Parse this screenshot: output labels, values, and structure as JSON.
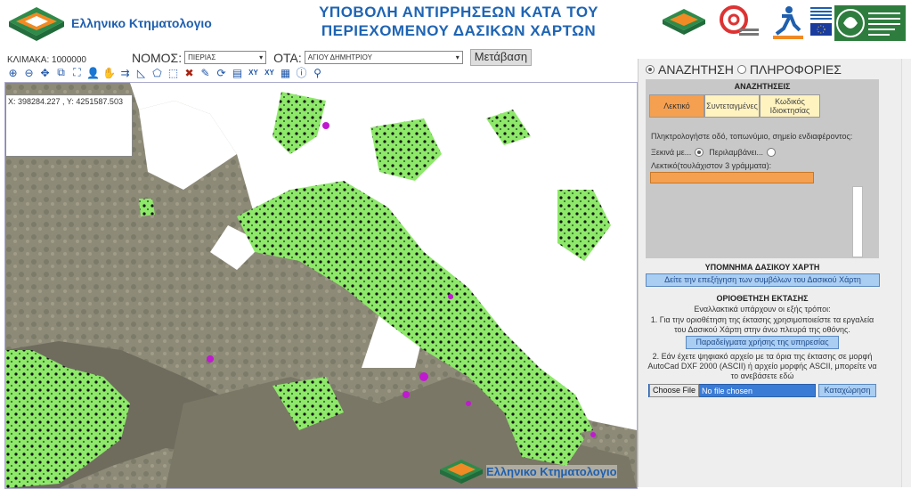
{
  "header": {
    "logo_text": "Ελληνικο Κτηματολογιο",
    "title_line1": "ΥΠΟΒΟΛΗ ΑΝΤΙΡΡΗΣΕΩΝ ΚΑΤΑ ΤΟΥ",
    "title_line2": "ΠΕΡΙΕΧΟΜΕΝΟΥ ΔΑΣΙΚΩΝ ΧΑΡΤΩΝ",
    "colors": {
      "title": "#1e64b4",
      "logo_orange": "#f08a24",
      "logo_green": "#2e8b4a"
    }
  },
  "toolbar": {
    "scale_label": "ΚΛΙΜΑΚΑ: 1000000",
    "nomos_label": "ΝΟΜΟΣ:",
    "nomos_value": "ΠΙΕΡΙΑΣ",
    "ota_label": "ΟΤΑ:",
    "ota_value": "ΑΓΙΟΥ ΔΗΜΗΤΡΙΟΥ",
    "go_label": "Μετάβαση",
    "tools": [
      "zoom-in-icon",
      "zoom-out-icon",
      "pan-icon",
      "zoom-box-icon",
      "zoom-extent-icon",
      "identify-icon",
      "hand-icon",
      "measure-line-icon",
      "measure-area-icon",
      "polygon-icon",
      "select-icon",
      "delete-icon",
      "edit-icon",
      "refresh-icon",
      "print-icon",
      "xy-icon",
      "xy-goto-icon",
      "layers-icon",
      "info-icon",
      "locate-icon"
    ]
  },
  "map": {
    "coords": "X: 398284.227 , Y: 4251587.503",
    "logo_text": "Ελληνικο Κτηματολογιο"
  },
  "panel": {
    "radio_search": "ΑΝΑΖΗΤΗΣΗ",
    "radio_info": "ΠΛΗΡΟΦΟΡΙΕΣ",
    "search_header": "ΑΝΑΖΗΤΗΣΕΙΣ",
    "tabs": [
      "Λεκτικό",
      "Συντεταγμένες",
      "Κωδικός Ιδιοκτησίας"
    ],
    "hint": "Πληκτρολογήστε οδό, τοπωνύμιο, σημείο ενδιαφέροντος:",
    "opt_starts": "Ξεκινά με...",
    "opt_contains": "Περιλαμβάνει...",
    "input_label": "Λεκτικό(τουλάχιστον 3 γράμματα):",
    "legend_title": "ΥΠΟΜΝΗΜΑ ΔΑΣΙΚΟΥ ΧΑΡΤΗ",
    "legend_button": "Δείτε την επεξήγηση των συμβόλων του Δασικού Χάρτη",
    "area_title": "ΟΡΙΟΘΕΤΗΣΗ ΕΚΤΑΣΗΣ",
    "area_intro": "Εναλλακτικά υπάρχουν οι εξής τρόποι:",
    "area_step1": "1. Για την οριοθέτηση της έκτασης χρησιμοποιείστε τα εργαλεία του Δασικού Χάρτη στην άνω πλευρά της οθόνης.",
    "examples_button": "Παραδείγματα χρήσης της υπηρεσίας",
    "area_step2": "2. Εάν έχετε ψηφιακό αρχείο με τα όρια της έκτασης σε μορφή AutoCad DXF 2000 (ASCII) ή αρχείο μορφής ASCII, μπορείτε να το ανεβάσετε εδώ",
    "choose_file": "Choose File",
    "no_file": "No file chosen",
    "submit": "Καταχώρηση"
  }
}
